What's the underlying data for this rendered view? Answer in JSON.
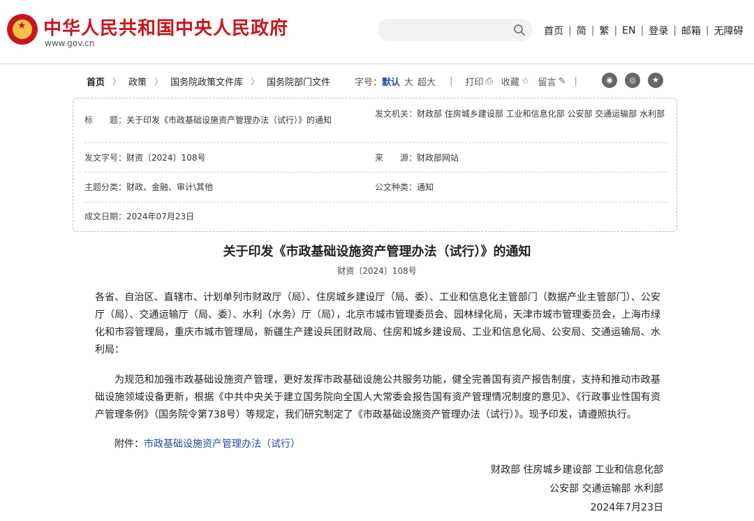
{
  "header": {
    "site_title": "中华人民共和国中央人民政府",
    "site_url": "www.gov.cn",
    "search": {
      "placeholder": "",
      "value": ""
    },
    "nav": [
      "首页",
      "简",
      "繁",
      "EN",
      "登录",
      "邮箱",
      "无障碍"
    ]
  },
  "breadcrumb": [
    "首页",
    "政策",
    "国务院政策文件库",
    "国务院部门文件"
  ],
  "toolbar": {
    "font_label": "字号：",
    "font_sizes": [
      "默认",
      "大",
      "超大"
    ],
    "print_label": "打印",
    "favorite_label": "收藏",
    "comment_label": "留言"
  },
  "info": {
    "title_label": "标　　题：",
    "title_value": "关于印发《市政基础设施资产管理办法（试行）》的通知",
    "issuer_label": "发文机关：",
    "issuer_value": "财政部 住房城乡建设部 工业和信息化部 公安部 交通运输部 水利部",
    "doc_no_label": "发文字号：",
    "doc_no_value": "财资〔2024〕108号",
    "source_label": "来　　源：",
    "source_value": "财政部网站",
    "topic_label": "主题分类：",
    "topic_value": "财政、金融、审计\\其他",
    "type_label": "公文种类：",
    "type_value": "通知",
    "date_label": "成文日期：",
    "date_value": "2024年07月23日"
  },
  "article": {
    "title": "关于印发《市政基础设施资产管理办法（试行）》的通知",
    "doc_no": "财资〔2024〕108号",
    "p1": "各省、自治区、直辖市、计划单列市财政厅（局）、住房城乡建设厅（局、委）、工业和信息化主管部门（数据产业主管部门）、公安厅（局）、交通运输厅（局、委）、水利（水务）厅（局），北京市城市管理委员会、园林绿化局，天津市城市管理委员会，上海市绿化和市容管理局，重庆市城市管理局，新疆生产建设兵团财政局、住房和城乡建设局、工业和信息化局、公安局、交通运输局、水利局：",
    "p2": "为规范和加强市政基础设施资产管理，更好发挥市政基础设施公共服务功能，健全完善国有资产报告制度，支持和推动市政基础设施领域设备更新，根据《中共中央关于建立国务院向全国人大常委会报告国有资产管理情况制度的意见》、《行政事业性国有资产管理条例》（国务院令第738号）等规定，我们研究制定了《市政基础设施资产管理办法（试行）》。现予印发，请遵照执行。",
    "attachment_label": "附件：",
    "attachment_link": "市政基础设施资产管理办法（试行）",
    "sign_line1": "财政部 住房城乡建设部 工业和信息化部",
    "sign_line2": "公安部 交通运输部 水利部",
    "sign_date": "2024年7月23日"
  }
}
